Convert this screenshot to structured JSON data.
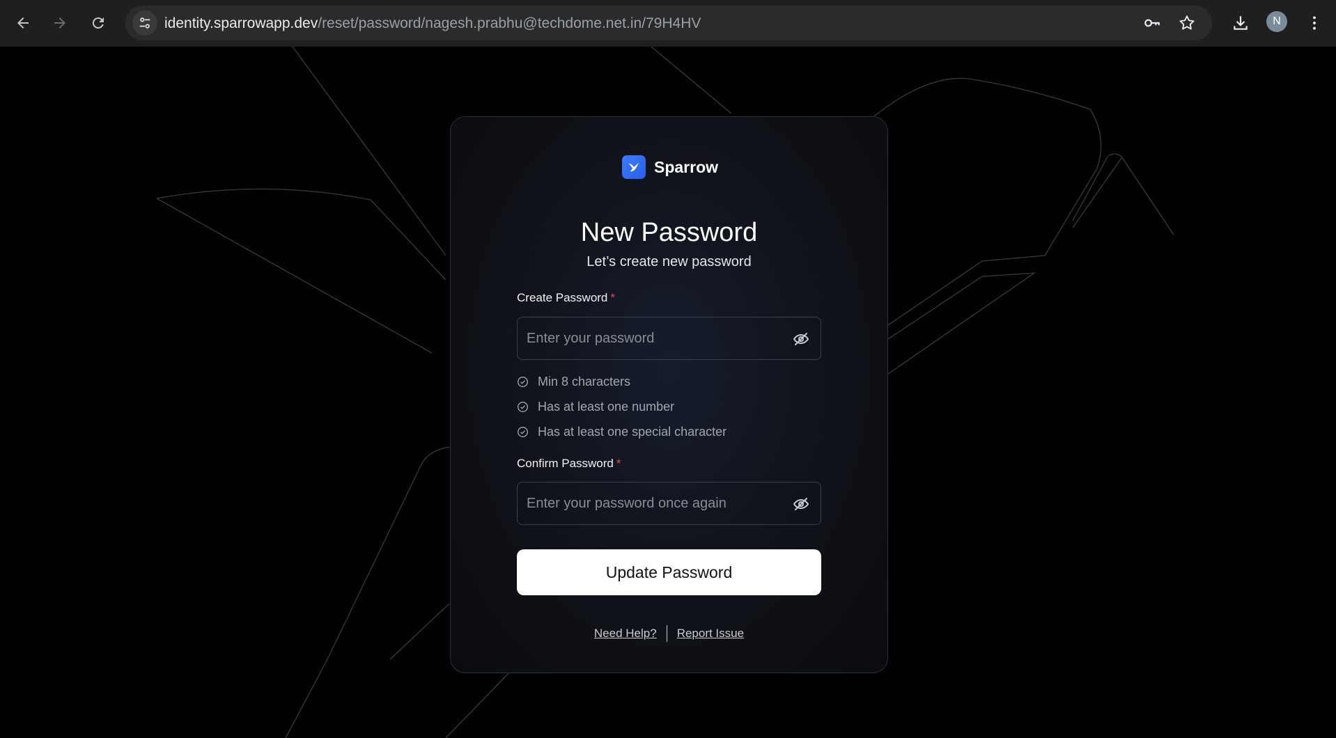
{
  "browser": {
    "url_host": "identity.sparrowapp.dev",
    "url_path": "/reset/password/nagesh.prabhu@techdome.net.in/79H4HV",
    "profile_initial": "N"
  },
  "brand": {
    "name": "Sparrow",
    "accent": "#2f6bf4"
  },
  "form": {
    "title": "New Password",
    "subtitle": "Let’s create new password",
    "create_label": "Create Password",
    "create_placeholder": "Enter your password",
    "confirm_label": "Confirm Password",
    "confirm_placeholder": "Enter your password once again",
    "required_marker": "*",
    "rules": [
      "Min 8 characters",
      "Has at least one number",
      "Has at least one special character"
    ],
    "submit_label": "Update Password"
  },
  "footer": {
    "help_label": "Need Help?",
    "report_label": "Report Issue"
  }
}
